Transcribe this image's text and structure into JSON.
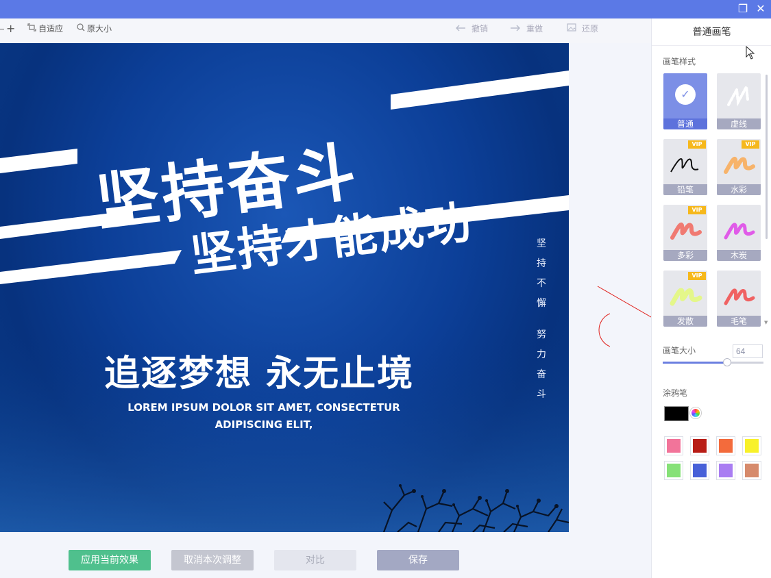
{
  "window": {
    "restore_glyph": "❐",
    "close_glyph": "✕"
  },
  "toolbar": {
    "zoom_in_glyph": "+",
    "fit_label": "自适应",
    "fit_icon": "fit-icon",
    "original_size_label": "原大小",
    "original_size_icon": "magnifier-icon",
    "undo_label": "撤销",
    "redo_label": "重做",
    "restore_label": "还原"
  },
  "poster": {
    "headline_1": "坚持奋斗",
    "headline_2": "坚持才能成功",
    "subhead": "追逐梦想 永无止境",
    "lorem_line_1": "LOREM IPSUM DOLOR SIT AMET, CONSECTETUR",
    "lorem_line_2": "ADIPISCING ELIT,",
    "vertical_1": [
      "坚",
      "持",
      "不",
      "懈"
    ],
    "vertical_2": [
      "努",
      "力",
      "奋",
      "斗"
    ]
  },
  "bottom_buttons": {
    "apply": "应用当前效果",
    "cancel": "取消本次调整",
    "compare": "对比",
    "save": "保存"
  },
  "panel": {
    "title": "普通画笔",
    "brush_style_label": "画笔样式",
    "brushes": [
      {
        "label": "普通",
        "vip": "",
        "selected": true,
        "icon": "check-icon"
      },
      {
        "label": "虚线",
        "vip": "",
        "selected": false,
        "icon": "dashed-stroke-icon"
      },
      {
        "label": "铅笔",
        "vip": "VIP",
        "selected": false,
        "icon": "pencil-stroke-icon"
      },
      {
        "label": "水彩",
        "vip": "VIP",
        "selected": false,
        "icon": "watercolor-stroke-icon"
      },
      {
        "label": "多彩",
        "vip": "VIP",
        "selected": false,
        "icon": "multicolor-stroke-icon"
      },
      {
        "label": "木炭",
        "vip": "",
        "selected": false,
        "icon": "charcoal-stroke-icon"
      },
      {
        "label": "发散",
        "vip": "VIP",
        "selected": false,
        "icon": "diffuse-stroke-icon"
      },
      {
        "label": "毛笔",
        "vip": "",
        "selected": false,
        "icon": "ink-brush-stroke-icon"
      }
    ],
    "brush_size_label": "画笔大小",
    "brush_size_value": "64",
    "brush_size_max": 100,
    "graffiti_label": "涂鸦笔",
    "current_color": "#000000",
    "palette": [
      "#f2749a",
      "#b81c16",
      "#f36b3c",
      "#f8f12a",
      "#86e178",
      "#4760d8",
      "#a97df2",
      "#d68a6c"
    ]
  },
  "colors": {
    "accent": "#5b79e6",
    "apply_button": "#4fc08d",
    "cancel_button": "#c4c6d0",
    "compare_button": "#e4e6ee",
    "save_button": "#a3a8c3"
  }
}
